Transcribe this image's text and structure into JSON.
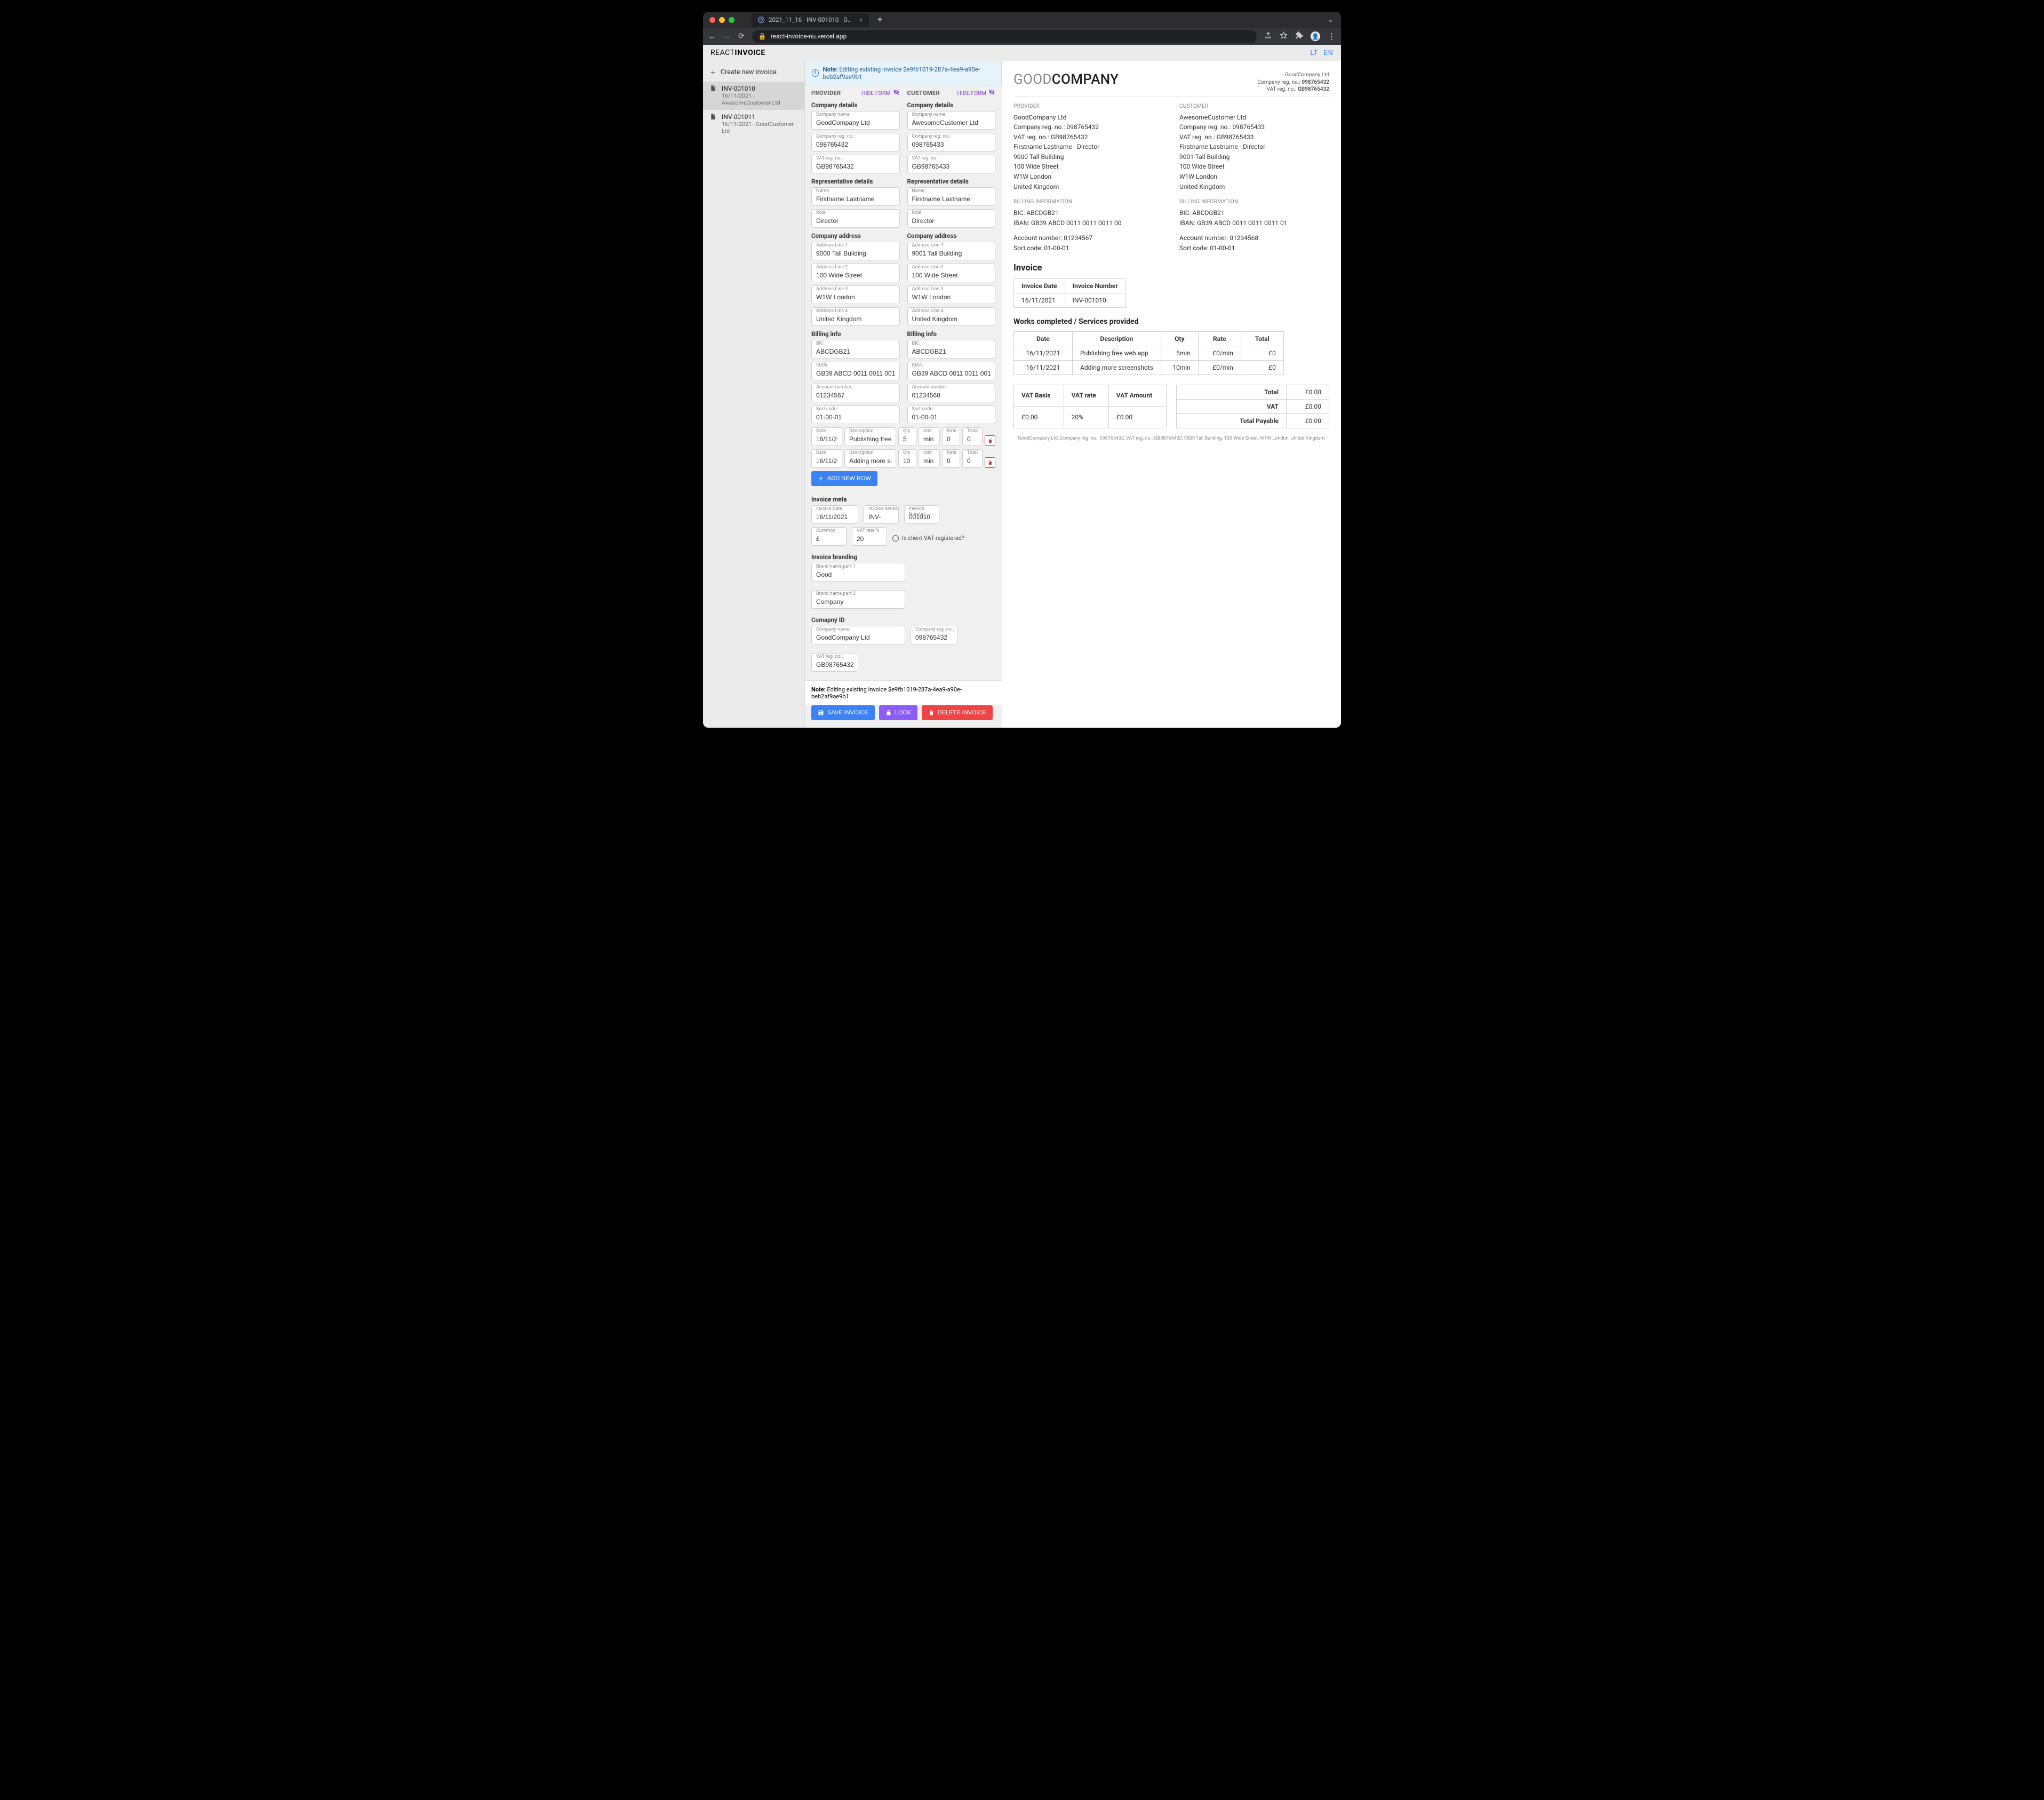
{
  "browser": {
    "tab_title": "2021_11_16 - INV-001010 - G…",
    "url": "react-invoice-nu.vercel.app"
  },
  "brand": {
    "light": "REACT",
    "bold": "INVOICE"
  },
  "langs": {
    "lt": "LT",
    "en": "EN"
  },
  "sidebar": {
    "create": "Create new invoice",
    "items": [
      {
        "id": "INV-001010",
        "meta": "16/11/2021 - AwesomeCustomer Ltd"
      },
      {
        "id": "INV-001011",
        "meta": "16/11/2021 - GreatCustomer Ltd"
      }
    ]
  },
  "note": {
    "label": "Note:",
    "text": "Editing existing invoice $e9fb1019-287a-4ea9-a90e-beb2af9ae9b1"
  },
  "provider_label": "PROVIDER",
  "customer_label": "CUSTOMER",
  "hide_form": "HIDE FORM",
  "sections": {
    "company_details": "Company details",
    "rep_details": "Representative details",
    "addr": "Company address",
    "billing": "Billing info",
    "meta": "Invoice meta",
    "branding": "Invoice branding",
    "cid": "Comapny ID"
  },
  "labels": {
    "company_name": "Company name",
    "reg": "Company reg. no.:",
    "vat": "VAT reg. no.:",
    "name": "Name",
    "role": "Role",
    "a1": "Address Line 1",
    "a2": "Address Line 2",
    "a3": "Address Line 3",
    "a4": "Address Line 4",
    "bic": "BIC:",
    "iban": "IBAN:",
    "acct": "Account number:",
    "sort": "Sort code:",
    "date": "Date",
    "desc": "Description",
    "qty": "Qty",
    "unit": "Unit",
    "rate": "Rate",
    "total": "Total",
    "inv_date": "Invoice Date",
    "inv_series": "Invoice series",
    "inv_no": "Invoice Number",
    "currency": "Currency",
    "vatrate": "VAT rate %",
    "vatreg": "Is client VAT registered?",
    "bp1": "Brand name part 1",
    "bp2": "Brand name part 2"
  },
  "provider": {
    "company_name": "GoodCompany Ltd",
    "reg": "098765432",
    "vat": "GB98765432",
    "name": "Firstname Lastname",
    "role": "Director",
    "a1": "9000 Tall Building",
    "a2": "100 Wide Street",
    "a3": "W1W London",
    "a4": "United Kingdom",
    "bic": "ABCDGB21",
    "iban": "GB39 ABCD 0011 0011 0011 00",
    "acct": "01234567",
    "sort": "01-00-01"
  },
  "customer": {
    "company_name": "AwesomeCustomer Ltd",
    "reg": "098765433",
    "vat": "GB98765433",
    "name": "Firstname Lastname",
    "role": "Director",
    "a1": "9001 Tall Building",
    "a2": "100 Wide Street",
    "a3": "W1W London",
    "a4": "United Kingdom",
    "bic": "ABCDGB21",
    "iban": "GB39 ABCD 0011 0011 0011 01",
    "acct": "01234568",
    "sort": "01-00-01"
  },
  "rows": [
    {
      "date": "16/11/2021",
      "desc": "Publishing free web app",
      "qty": "5",
      "unit": "min",
      "rate": "0",
      "total": "0"
    },
    {
      "date": "16/11/2021",
      "desc": "Adding more screenshots",
      "qty": "10",
      "unit": "min",
      "rate": "0",
      "total": "0"
    }
  ],
  "add_row_label": "ADD NEW ROW",
  "meta": {
    "date": "16/11/2021",
    "series": "INV-",
    "no": "001010",
    "currency": "£",
    "vatrate": "20"
  },
  "branding": {
    "p1": "Good",
    "p2": "Company"
  },
  "cid": {
    "name": "GoodCompany Ltd",
    "reg": "098765432",
    "vat": "GB98765432"
  },
  "buttons": {
    "save": "SAVE INVOICE",
    "lock": "LOCK",
    "delete": "DELETE INVOICE"
  },
  "preview": {
    "brand1": "GOOD",
    "brand2": "COMPANY",
    "meta": [
      "GoodCompany Ltd",
      "Company reg. no.: 098765432",
      "VAT reg. no.: GB98765432"
    ],
    "prov_lines": [
      "GoodCompany Ltd",
      "Company reg. no.: 098765432",
      "VAT reg. no.: GB98765432",
      "Firstname Lastname - Director",
      "9000 Tall Building",
      "100 Wide Street",
      "W1W London",
      "United Kingdom"
    ],
    "cust_lines": [
      "AwesomeCustomer Ltd",
      "Company reg. no.: 098765433",
      "VAT reg. no.: GB98765433",
      "Firstname Lastname - Director",
      "9001 Tall Building",
      "100 Wide Street",
      "W1W London",
      "United Kingdom"
    ],
    "bill_label": "BILLING INFORMATION",
    "prov_bill": [
      "BIC: ABCDGB21",
      "IBAN: GB39 ABCD 0011 0011 0011 00"
    ],
    "prov_bill2": [
      "Account number: 01234567",
      "Sort code: 01-00-01"
    ],
    "cust_bill": [
      "BIC: ABCDGB21",
      "IBAN: GB39 ABCD 0011 0011 0011 01"
    ],
    "cust_bill2": [
      "Account number: 01234568",
      "Sort code: 01-00-01"
    ],
    "inv_title": "Invoice",
    "inv_head": [
      "Invoice Date",
      "Invoice Number"
    ],
    "inv_row": [
      "16/11/2021",
      "INV-001010"
    ],
    "works_title": "Works completed / Services provided",
    "svc_head": [
      "Date",
      "Description",
      "Qty",
      "Rate",
      "Total"
    ],
    "svc_rows": [
      [
        "16/11/2021",
        "Publishing free web app",
        "5min",
        "£0/min",
        "£0"
      ],
      [
        "16/11/2021",
        "Adding more screenshots",
        "10min",
        "£0/min",
        "£0"
      ]
    ],
    "vat_head": [
      "VAT Basis",
      "VAT rate",
      "VAT Amount"
    ],
    "vat_row": [
      "£0.00",
      "20%",
      "£0.00"
    ],
    "totals": [
      [
        "Total",
        "£0.00"
      ],
      [
        "VAT",
        "£0.00"
      ],
      [
        "Total Payable",
        "£0.00"
      ]
    ],
    "footer": "GoodCompany Ltd,  Company reg. no.: 098765432,  VAT reg. no.: GB98765432,  9000 Tall Building,  100 Wide Street,  W1W London,  United Kingdom"
  }
}
